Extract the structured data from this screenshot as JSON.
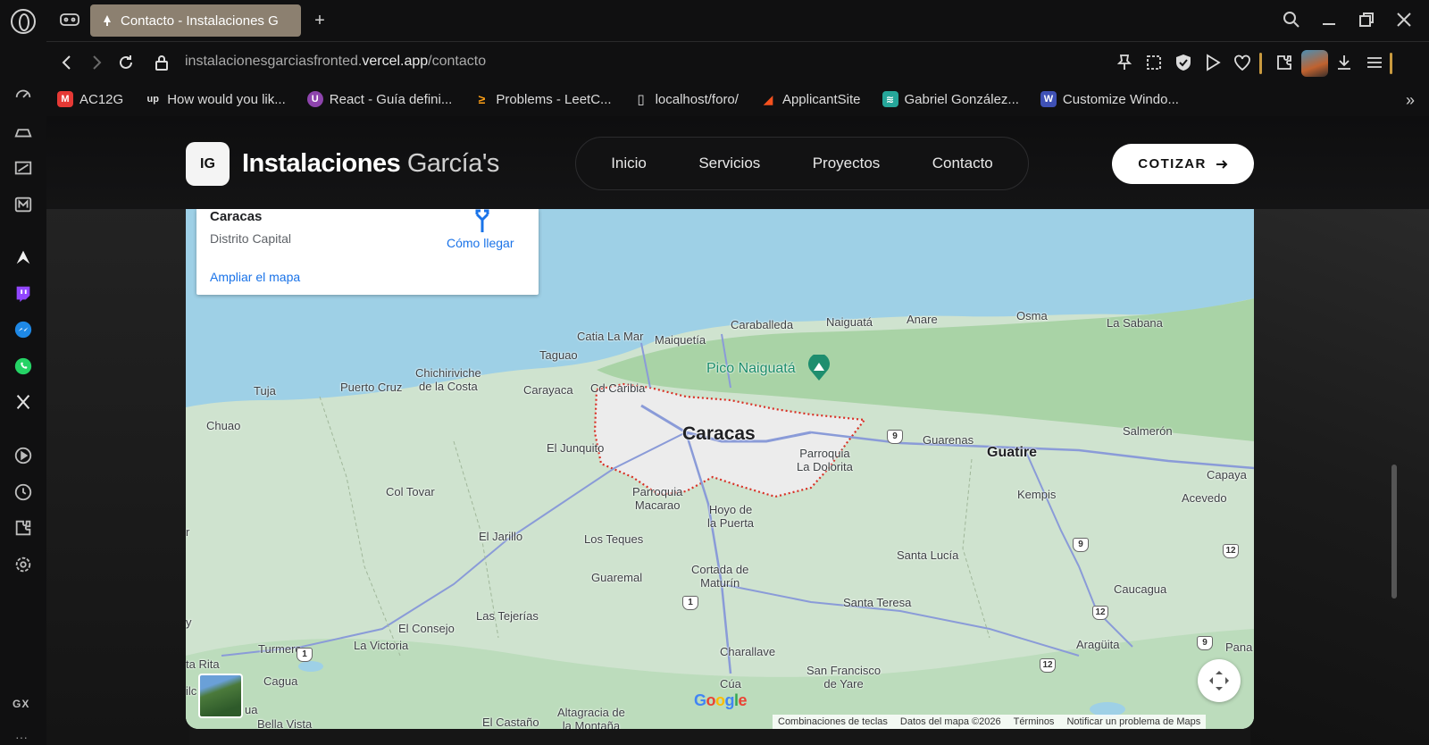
{
  "browser": {
    "tab": {
      "title": "Contacto - Instalaciones G"
    },
    "address": {
      "host_prefix": "instalacionesgarciasfronted.",
      "host_domain": "vercel.app",
      "path": "/contacto"
    },
    "bookmarks": [
      {
        "label": "AC12G",
        "color": "#e53935",
        "glyph": "M"
      },
      {
        "label": "How would you lik...",
        "color": "#101011",
        "glyph": "up"
      },
      {
        "label": "React - Guía defini...",
        "color": "#8e44ad",
        "glyph": "U"
      },
      {
        "label": "Problems - LeetC...",
        "color": "#101011",
        "glyph": "≥"
      },
      {
        "label": "localhost/foro/",
        "color": "#101011",
        "glyph": "▯"
      },
      {
        "label": "ApplicantSite",
        "color": "#f4511e",
        "glyph": "◢"
      },
      {
        "label": "Gabriel González...",
        "color": "#26a69a",
        "glyph": "≋"
      },
      {
        "label": "Customize Windo...",
        "color": "#3f51b5",
        "glyph": "W"
      }
    ],
    "sidebar_label": "GX"
  },
  "site": {
    "brand": {
      "badge": "IG",
      "name_bold": "Instalaciones",
      "name_light": "García's"
    },
    "nav": [
      "Inicio",
      "Servicios",
      "Proyectos",
      "Contacto"
    ],
    "cta": "COTIZAR"
  },
  "map": {
    "card": {
      "title": "Caracas",
      "subtitle": "Distrito Capital",
      "directions": "Cómo llegar",
      "enlarge": "Ampliar el mapa"
    },
    "places": {
      "caracas": "Caracas",
      "guatire": "Guatire",
      "pico": "Pico Naiguatá",
      "catia": "Catia La Mar",
      "maiquetia": "Maiquetía",
      "caraballeda": "Caraballeda",
      "naiguata": "Naiguatá",
      "anare": "Anare",
      "osma": "Osma",
      "lasabana": "La Sabana",
      "taguao": "Taguao",
      "chichiriviche": "Chichiriviche\nde la Costa",
      "tuja": "Tuja",
      "puertocruz": "Puerto Cruz",
      "carayaca": "Carayaca",
      "cdcaribia": "Cd Caribia",
      "chuao": "Chuao",
      "junquito": "El Junquito",
      "dolorita": "Parroquia\nLa Dolorita",
      "guarenas": "Guarenas",
      "salmeron": "Salmerón",
      "coltovar": "Col Tovar",
      "macarao": "Parroquia\nMacarao",
      "hoyo": "Hoyo de\nla Puerta",
      "kempis": "Kempis",
      "capaya": "Capaya",
      "acevedo": "Acevedo",
      "jarillo": "El Jarillo",
      "losteques": "Los Teques",
      "santalucia": "Santa Lucía",
      "cortada": "Cortada de\nMaturín",
      "guaremal": "Guaremal",
      "caucagua": "Caucagua",
      "santateresa": "Santa Teresa",
      "consejo": "El Consejo",
      "lastejerias": "Las Tejerías",
      "turmero": "Turmero",
      "victoria": "La Victoria",
      "rita": "ta Rita",
      "aragüita": "Aragüita",
      "charallave": "Charallave",
      "sanfrancisco": "San Francisco\nde Yare",
      "cua": "Cúa",
      "cagua": "Cagua",
      "castano": "El Castaño",
      "altagracia": "Altagracia de\nla Montaña",
      "pana": "Pana",
      "bellavista": "Bella Vista",
      "ua": "ua",
      "ilc": "ilc",
      "r": "r",
      "y": "y"
    },
    "shields": {
      "s9a": "9",
      "s9b": "9",
      "s9c": "9",
      "s12a": "12",
      "s12b": "12",
      "s12c": "12",
      "s1a": "1",
      "s1b": "1"
    },
    "google": "Google",
    "attribution": [
      "Combinaciones de teclas",
      "Datos del mapa ©2026",
      "Términos",
      "Notificar un problema de Maps"
    ]
  }
}
